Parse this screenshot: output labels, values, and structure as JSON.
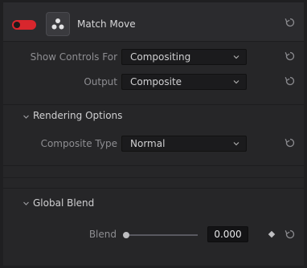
{
  "header": {
    "title": "Match Move",
    "enabled": true
  },
  "controls": {
    "show_controls_for": {
      "label": "Show Controls For",
      "value": "Compositing"
    },
    "output": {
      "label": "Output",
      "value": "Composite"
    }
  },
  "rendering_options": {
    "title": "Rendering Options",
    "composite_type": {
      "label": "Composite Type",
      "value": "Normal"
    }
  },
  "global_blend": {
    "title": "Global Blend",
    "blend": {
      "label": "Blend",
      "value": "0.000",
      "level": 0
    }
  },
  "colors": {
    "toggle_on": "#d8262d",
    "panel_bg": "#28282b"
  }
}
